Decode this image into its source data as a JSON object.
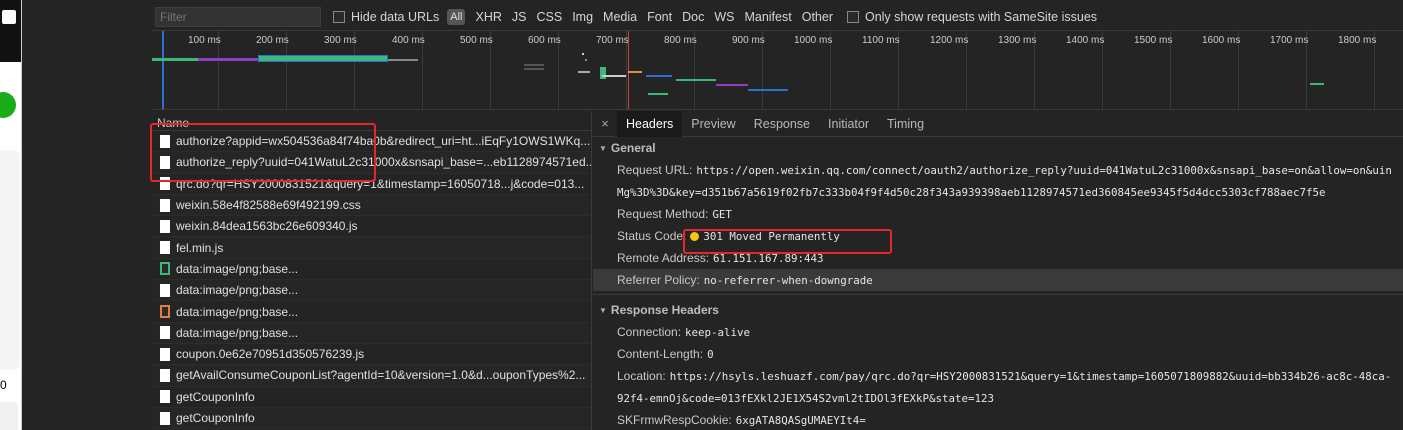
{
  "phone": {
    "zero_digit": "0"
  },
  "filterbar": {
    "filter_placeholder": "Filter",
    "hide_data_urls": "Hide data URLs",
    "all_label": "All",
    "types": [
      "XHR",
      "JS",
      "CSS",
      "Img",
      "Media",
      "Font",
      "Doc",
      "WS",
      "Manifest",
      "Other"
    ],
    "samesite_label": "Only show requests with SameSite issues"
  },
  "overview": {
    "ticks": [
      "100 ms",
      "200 ms",
      "300 ms",
      "400 ms",
      "500 ms",
      "600 ms",
      "700 ms",
      "800 ms",
      "900 ms",
      "1000 ms",
      "1100 ms",
      "1200 ms",
      "1300 ms",
      "1400 ms",
      "1500 ms",
      "1600 ms",
      "1700 ms",
      "1800 ms"
    ]
  },
  "list": {
    "header": "Name",
    "rows": [
      {
        "name": "authorize?appid=wx504536a84f74ba0b&redirect_uri=ht...iEqFy1OWS1WKq...",
        "icon": "file-icon"
      },
      {
        "name": "authorize_reply?uuid=041WatuL2c31000x&snsapi_base=...eb1128974571ed...",
        "icon": "file-icon"
      },
      {
        "name": "qrc.do?qr=HSY2000831521&query=1&timestamp=16050718...j&code=013...",
        "icon": "file-icon"
      },
      {
        "name": "weixin.58e4f82588e69f492199.css",
        "icon": "file-icon"
      },
      {
        "name": "weixin.84dea1563bc26e609340.js",
        "icon": "file-icon"
      },
      {
        "name": "fel.min.js",
        "icon": "file-icon"
      },
      {
        "name": "data:image/png;base...",
        "icon": "image-green-icon"
      },
      {
        "name": "data:image/png;base...",
        "icon": "image-dark-icon"
      },
      {
        "name": "data:image/png;base...",
        "icon": "image-orange-icon"
      },
      {
        "name": "data:image/png;base...",
        "icon": "image-icon"
      },
      {
        "name": "coupon.0e62e70951d350576239.js",
        "icon": "file-icon"
      },
      {
        "name": "getAvailConsumeCouponList?agentId=10&version=1.0&d...ouponTypes%2...",
        "icon": "file-icon"
      },
      {
        "name": "getCouponInfo",
        "icon": "file-icon"
      },
      {
        "name": "getCouponInfo",
        "icon": "file-icon"
      }
    ]
  },
  "details": {
    "close": "×",
    "tabs": [
      "Headers",
      "Preview",
      "Response",
      "Initiator",
      "Timing"
    ],
    "general_title": "General",
    "request_url_key": "Request URL:",
    "request_url_val": "https://open.weixin.qq.com/connect/oauth2/authorize_reply?uuid=041WatuL2c31000x&snsapi_base=on&allow=on&uin",
    "request_url_val2": "Mg%3D%3D&key=d351b67a5619f02fb7c333b04f9f4d50c28f343a939398aeb1128974571ed360845ee9345f5d4dcc5303cf788aec7f5e",
    "request_method_key": "Request Method:",
    "request_method_val": "GET",
    "status_code_key": "Status Code:",
    "status_code_val": "301 Moved Permanently",
    "remote_address_key": "Remote Address:",
    "remote_address_val": "61.151.167.89:443",
    "referrer_key": "Referrer Policy:",
    "referrer_val": "no-referrer-when-downgrade",
    "response_headers_title": "Response Headers",
    "connection_key": "Connection:",
    "connection_val": "keep-alive",
    "content_length_key": "Content-Length:",
    "content_length_val": "0",
    "location_key": "Location:",
    "location_val": "https://hsyls.leshuazf.com/pay/qrc.do?qr=HSY2000831521&query=1&timestamp=1605071809882&uuid=bb334b26-ac8c-48ca-",
    "location_val2": "92f4-emnOj&code=013fEXkl2JE1X54S2vml2tIDOl3fEXkP&state=123",
    "cookie_key": "SKFrmwRespCookie:",
    "cookie_val": "6xgATA8QASgUMAEYIt4="
  }
}
